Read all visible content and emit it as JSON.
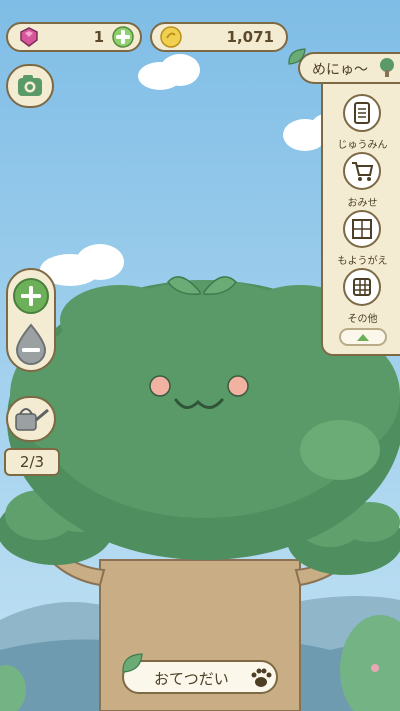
{
  "currency": {
    "gems": "1",
    "coins": "1,071"
  },
  "menu": {
    "title": "めにゅ〜",
    "items": [
      {
        "label": "じゅうみん",
        "icon": "resident-book-icon"
      },
      {
        "label": "おみせ",
        "icon": "shopping-cart-icon"
      },
      {
        "label": "もようがえ",
        "icon": "redecorate-icon"
      },
      {
        "label": "その他",
        "icon": "more-grid-icon"
      }
    ]
  },
  "watering": {
    "count": "2/3"
  },
  "help_button": {
    "label": "おてつだい"
  },
  "colors": {
    "sky": "#a9d4ef",
    "tree_foliage": "#5a9a68",
    "trunk": "#c8ad85",
    "panel_bg": "#f3ecd3",
    "panel_border": "#7d6a44",
    "accent_green": "#6cb05a"
  }
}
